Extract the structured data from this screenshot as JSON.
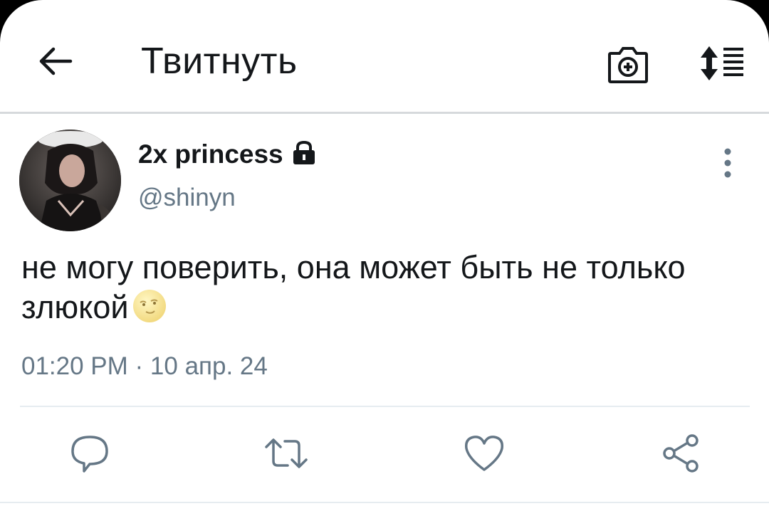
{
  "header": {
    "title": "Твитнуть",
    "back_icon": "back-arrow-icon",
    "camera_icon": "camera-add-icon",
    "sort_icon": "sort-list-icon"
  },
  "tweet": {
    "display_name": "2x princess",
    "handle": "@shinyn",
    "protected": true,
    "text": "не могу поверить, она может быть не только злюкой",
    "emoji": "moon-face-emoji",
    "timestamp": "01:20 PM · 10 апр. 24"
  },
  "actions": [
    "reply-icon",
    "retweet-icon",
    "like-icon",
    "share-icon"
  ],
  "colors": {
    "primary_text": "#14171a",
    "secondary_text": "#657786",
    "icon": "#1da1f2"
  }
}
